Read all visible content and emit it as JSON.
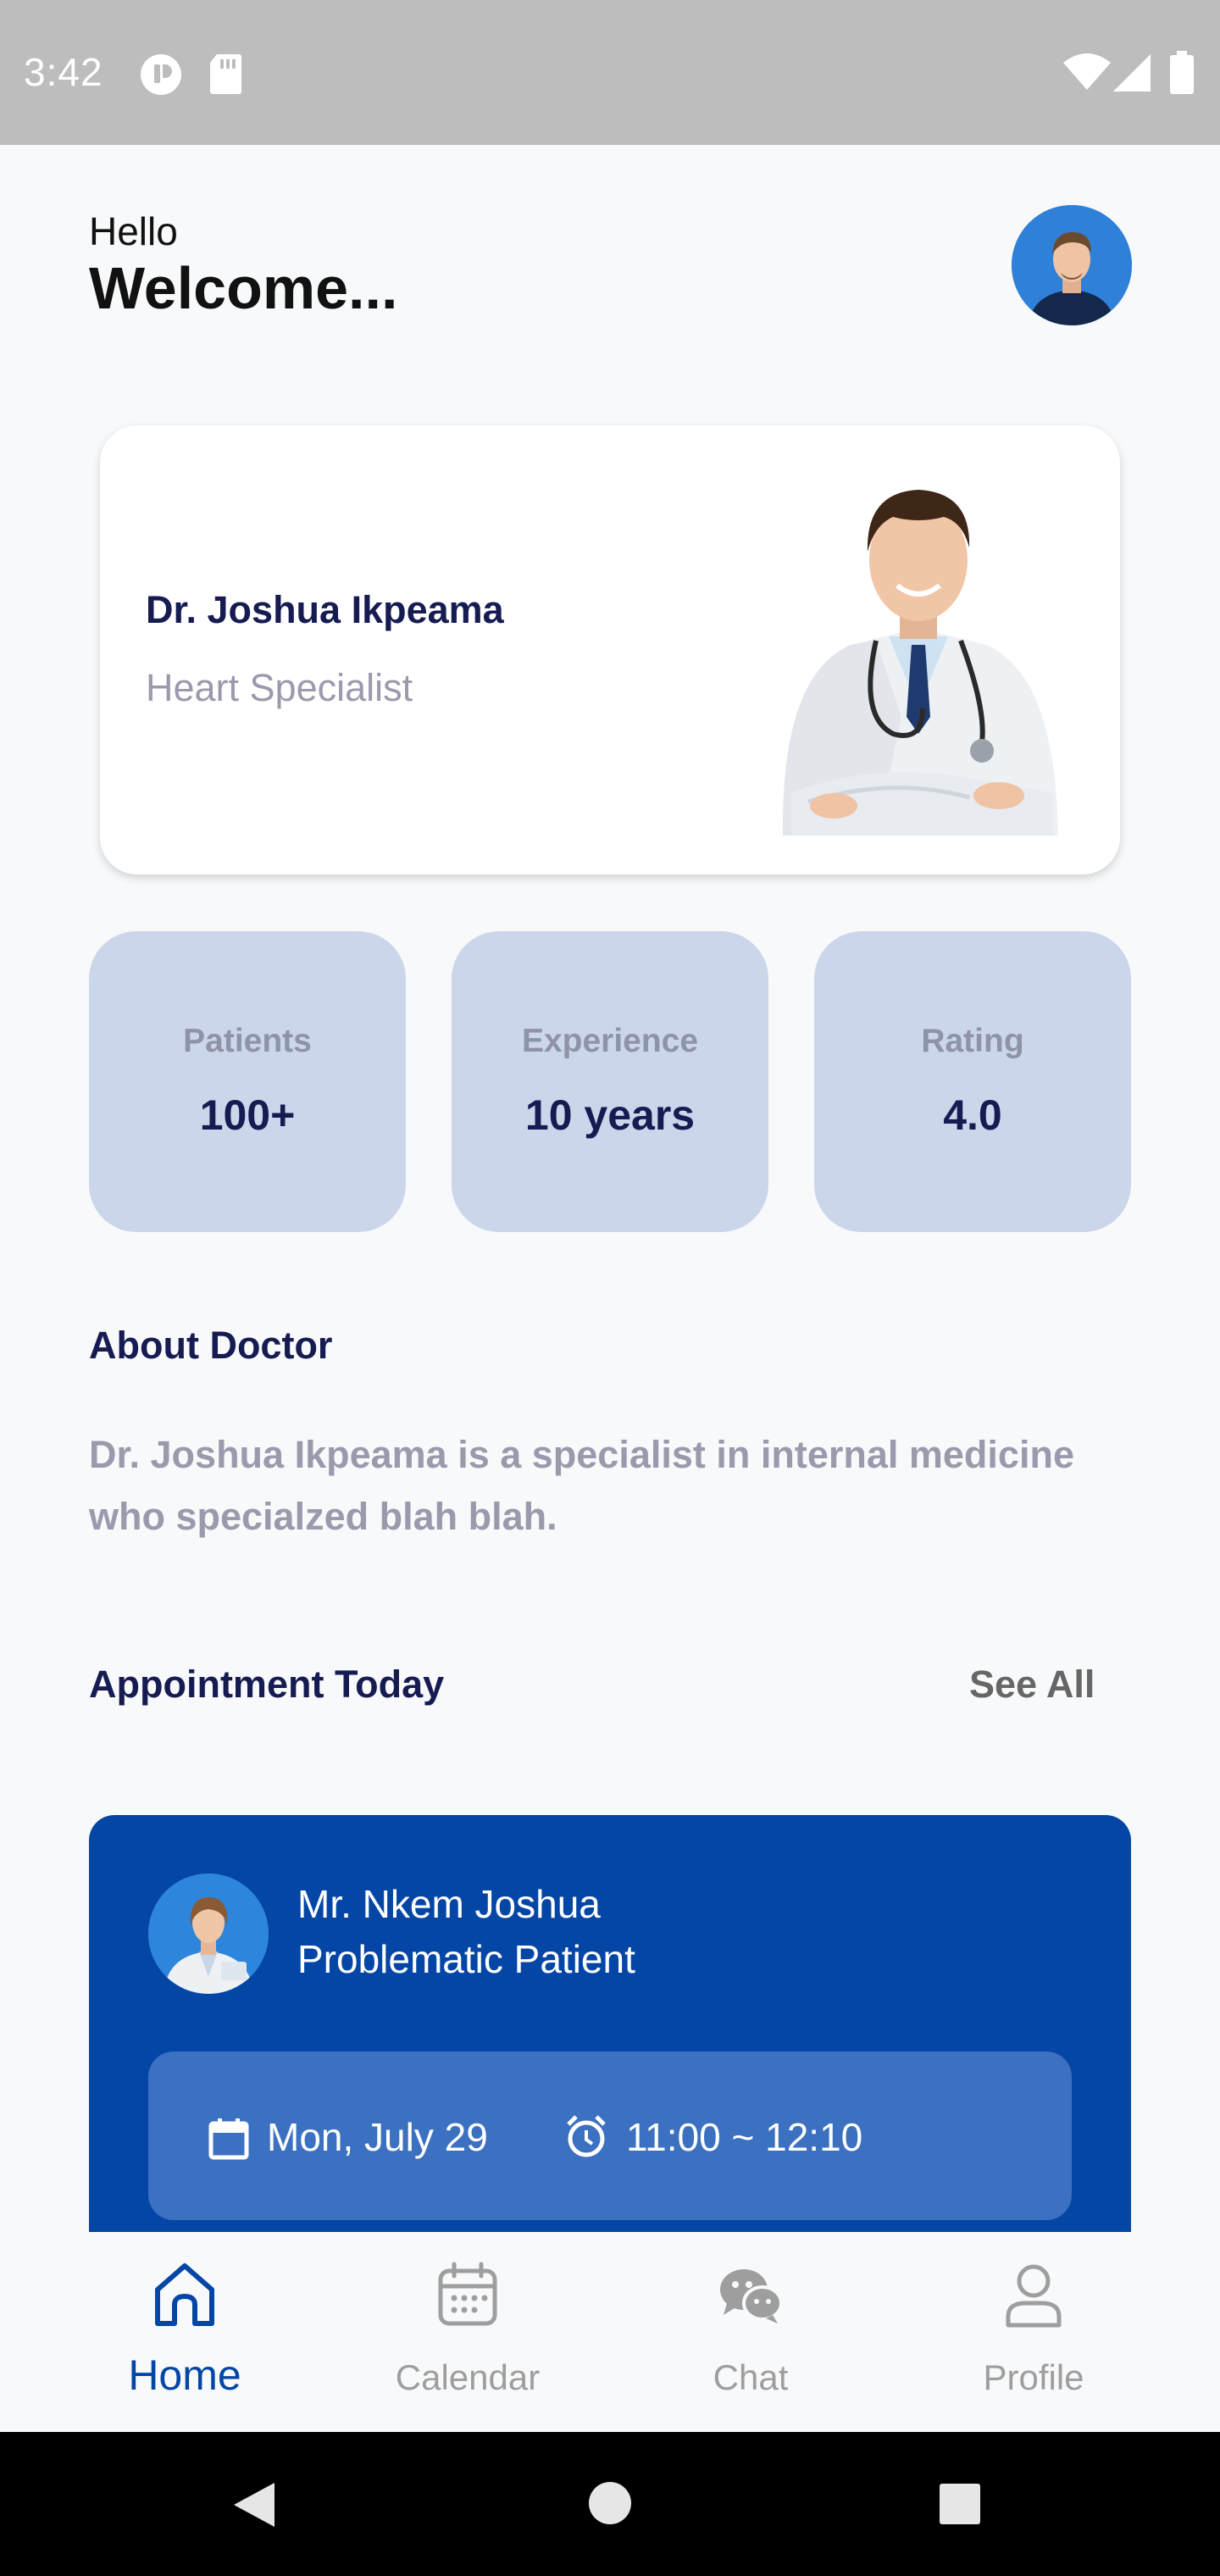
{
  "status_bar": {
    "time": "3:42",
    "left_icons": [
      "circle-badge-icon",
      "sd-card-icon"
    ],
    "right_icons": [
      "wifi-icon",
      "signal-icon",
      "battery-icon"
    ]
  },
  "header": {
    "greeting": "Hello",
    "welcome": "Welcome..."
  },
  "doctor": {
    "name": "Dr. Joshua Ikpeama",
    "specialty": "Heart Specialist"
  },
  "stats": [
    {
      "label": "Patients",
      "value": "100+"
    },
    {
      "label": "Experience",
      "value": "10 years"
    },
    {
      "label": "Rating",
      "value": "4.0"
    }
  ],
  "about": {
    "title": "About Doctor",
    "text": "Dr. Joshua Ikpeama is a specialist in internal medicine who specialzed blah blah."
  },
  "appointments": {
    "title": "Appointment Today",
    "see_all": "See All",
    "items": [
      {
        "patient_name": "Mr. Nkem Joshua",
        "note": "Problematic Patient",
        "date": "Mon, July 29",
        "time": "11:00 ~ 12:10"
      }
    ]
  },
  "nav": {
    "items": [
      {
        "label": "Home",
        "icon": "home-icon",
        "active": true
      },
      {
        "label": "Calendar",
        "icon": "calendar-icon",
        "active": false
      },
      {
        "label": "Chat",
        "icon": "chat-icon",
        "active": false
      },
      {
        "label": "Profile",
        "icon": "profile-icon",
        "active": false
      }
    ]
  },
  "colors": {
    "primary": "#0446a6",
    "stat_card": "#cbd6ea",
    "heading": "#161b52",
    "muted": "#9a9aad"
  }
}
